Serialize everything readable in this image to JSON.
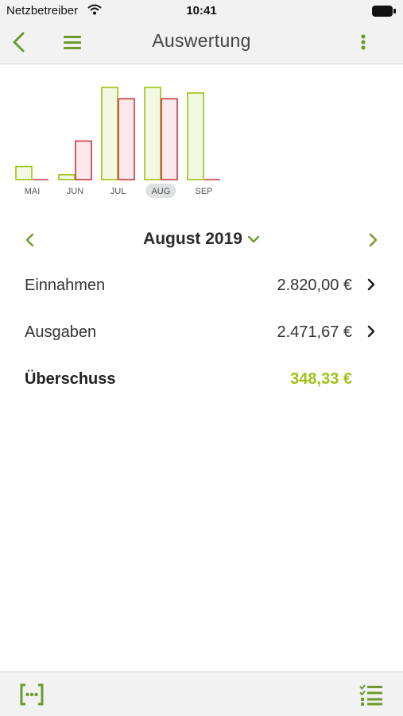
{
  "status": {
    "carrier": "Netzbetreiber",
    "time": "10:41"
  },
  "nav": {
    "title": "Auswertung",
    "back_icon": "chevron-left-icon",
    "menu_icon": "hamburger-icon",
    "more_icon": "more-vertical-icon"
  },
  "colors": {
    "accent": "#6e9a2c",
    "income_fill": "#f2f8e3",
    "income_stroke": "#9cc312",
    "expense_fill": "#fce9ec",
    "expense_stroke": "#c7383f",
    "surplus": "#9cc312"
  },
  "chart_data": {
    "type": "bar",
    "categories": [
      "MAI",
      "JUN",
      "JUL",
      "AUG",
      "SEP"
    ],
    "selected": "AUG",
    "series": [
      {
        "values": [
          400,
          150,
          2820,
          2820,
          2650
        ]
      },
      {
        "values": [
          0,
          1180,
          2471.67,
          2471.67,
          0
        ]
      }
    ],
    "ylim": [
      0,
      2820
    ]
  },
  "period": {
    "label": "August 2019"
  },
  "summary": [
    {
      "label": "Einnahmen",
      "value": "2.820,00 €"
    },
    {
      "label": "Ausgaben",
      "value": "2.471,67 €"
    },
    {
      "label": "Überschuss",
      "value": "348,33 €"
    }
  ],
  "tabbar": {
    "left_icon": "scan-icon",
    "right_icon": "checklist-icon"
  }
}
